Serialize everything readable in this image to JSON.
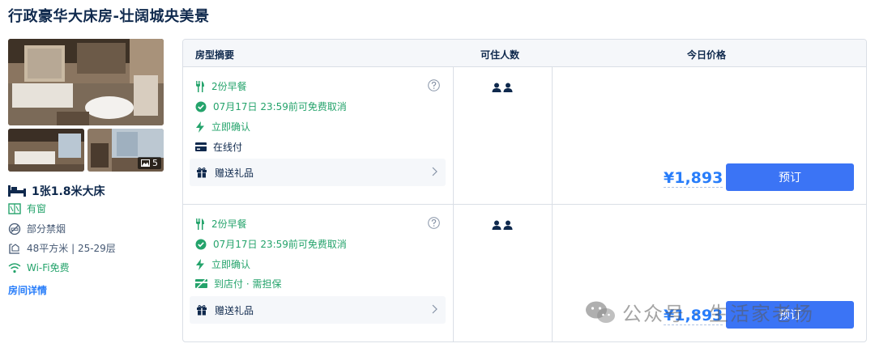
{
  "room": {
    "title": "行政豪华大床房-壮阔城央美景",
    "photo_count": "5",
    "bed": "1张1.8米大床",
    "features": [
      {
        "icon": "window-icon",
        "text": "有窗",
        "green": true
      },
      {
        "icon": "no-smoking-icon",
        "text": "部分禁烟",
        "green": false
      },
      {
        "icon": "area-icon",
        "text": "48平方米 | 25-29层",
        "green": false
      },
      {
        "icon": "wifi-icon",
        "text": "Wi-Fi免费",
        "green": true
      }
    ],
    "details_link": "房间详情"
  },
  "table": {
    "headers": {
      "summary": "房型摘要",
      "occupancy": "可住人数",
      "price": "今日价格"
    },
    "rows": [
      {
        "breakfast": "2份早餐",
        "cancel": "07月17日 23:59前可免费取消",
        "confirm": "立即确认",
        "payment": "在线付",
        "gift": "赠送礼品",
        "price": "¥1,893",
        "book": "预订"
      },
      {
        "breakfast": "2份早餐",
        "cancel": "07月17日 23:59前可免费取消",
        "confirm": "立即确认",
        "payment": "到店付 · 需担保",
        "gift": "赠送礼品",
        "price": "¥1,893",
        "book": "预订"
      }
    ]
  },
  "watermark": "公众号 · 生活家老杨",
  "colors": {
    "accent": "#287dfa",
    "button": "#3b74f5",
    "green": "#24a36b",
    "text": "#0f294d"
  }
}
